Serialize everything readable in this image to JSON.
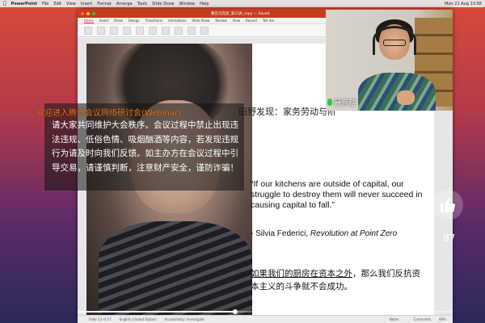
{
  "menubar": {
    "app": "PowerPoint",
    "items": [
      "File",
      "Edit",
      "View",
      "Insert",
      "Format",
      "Arrange",
      "Tools",
      "Slide Show",
      "Window",
      "Help"
    ],
    "clock": "Mon 21 Aug 13:58"
  },
  "window": {
    "title": "看见马克思_第三讲_copy — Saved",
    "ribbon_tabs": [
      "Home",
      "Insert",
      "Draw",
      "Design",
      "Transitions",
      "Animations",
      "Slide Show",
      "Review",
      "View",
      "Record",
      "Tell me"
    ],
    "active_tab": "Home"
  },
  "slide": {
    "heading": "田野发现：家务劳动与阶",
    "quote": "“If our kitchens are outside of capital, our struggle to destroy them will never succeed in causing capital to fall.”",
    "attribution_prefix": "- Silvia Federici, ",
    "attribution_book": "Revolution at Point Zero",
    "cn_quote_underlined": "如果我们的厨房在资本之外",
    "cn_quote_rest": "，那么我们反抗资本主义的斗争就不会成功。"
  },
  "statusbar": {
    "slide": "Slide 13 of 27",
    "language": "English (United States)",
    "accessibility": "Accessibility: Investigate",
    "notes": "Notes",
    "comments": "Comments",
    "zoom": "89%"
  },
  "video": {
    "progress": 0.42
  },
  "notice": {
    "title": "欢迎进入腾讯会议网络研讨会(Webinar)",
    "body": "请大家共同维护大会秩序。会议过程中禁止出现违法违规、低俗色情、吸烟酗酒等内容，若发现违规行为请及时向我们反馈。如主办方在会议过程中引导交易，请谨慎判断，注意财产安全，谨防诈骗！"
  },
  "webcam": {
    "speaker_name": "聂熹越"
  },
  "like": {
    "count": "87"
  }
}
